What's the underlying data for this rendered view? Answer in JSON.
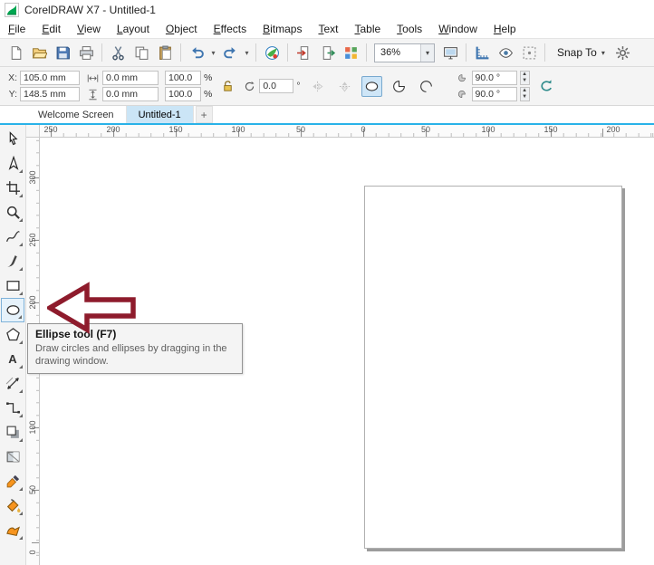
{
  "window": {
    "title": "CorelDRAW X7 - Untitled-1"
  },
  "menu": {
    "items": [
      "File",
      "Edit",
      "View",
      "Layout",
      "Object",
      "Effects",
      "Bitmaps",
      "Text",
      "Table",
      "Tools",
      "Window",
      "Help"
    ]
  },
  "standard_toolbar": {
    "buttons_left": [
      "new-document",
      "open",
      "save",
      "print",
      "|",
      "cut",
      "copy",
      "paste",
      "|",
      "undo",
      "undo-list",
      "redo",
      "redo-list",
      "|",
      "search-content",
      "|",
      "import",
      "export",
      "application-launcher",
      "|"
    ],
    "zoom_level": "36%",
    "buttons_mid": [
      "full-screen-preview",
      "|",
      "show-rulers",
      "preview",
      "dynamic-guides",
      "|"
    ],
    "snap_to_label": "Snap To",
    "buttons_right": [
      "options"
    ]
  },
  "property_bar": {
    "x_label": "X:",
    "x_value": "105.0 mm",
    "y_label": "Y:",
    "y_value": "148.5 mm",
    "width_value": "0.0 mm",
    "height_value": "0.0 mm",
    "scale_h_value": "100.0",
    "scale_v_value": "100.0",
    "percent": "%",
    "rotation_value": "0.0",
    "degree_symbol": "°",
    "start_angle_value": "90.0 °",
    "end_angle_value": "90.0 °"
  },
  "tabs": {
    "items": [
      {
        "label": "Welcome Screen",
        "active": false
      },
      {
        "label": "Untitled-1",
        "active": true
      }
    ],
    "new_tab_label": "+"
  },
  "rulers": {
    "horizontal_labels": [
      "250",
      "200",
      "150",
      "100",
      "50",
      "0",
      "50",
      "100",
      "150",
      "200"
    ],
    "vertical_labels": [
      "300",
      "250",
      "200",
      "150",
      "100",
      "50",
      "0"
    ]
  },
  "toolbox": {
    "tools": [
      {
        "name": "pick-tool",
        "flyout": false
      },
      {
        "name": "shape-tool",
        "flyout": true
      },
      {
        "name": "crop-tool",
        "flyout": true
      },
      {
        "name": "zoom-tool",
        "flyout": true
      },
      {
        "name": "freehand-tool",
        "flyout": true
      },
      {
        "name": "artistic-media-tool",
        "flyout": true
      },
      {
        "name": "rectangle-tool",
        "flyout": true
      },
      {
        "name": "ellipse-tool",
        "flyout": true,
        "highlighted": true
      },
      {
        "name": "polygon-tool",
        "flyout": true
      },
      {
        "name": "text-tool",
        "flyout": true
      },
      {
        "name": "parallel-dimension-tool",
        "flyout": true
      },
      {
        "name": "straight-line-connector-tool",
        "flyout": true
      },
      {
        "name": "drop-shadow-tool",
        "flyout": true
      },
      {
        "name": "transparency-tool",
        "flyout": false
      },
      {
        "name": "color-eyedropper-tool",
        "flyout": true
      },
      {
        "name": "interactive-fill-tool",
        "flyout": true
      },
      {
        "name": "smart-fill-tool",
        "flyout": true
      }
    ]
  },
  "tooltip": {
    "title": "Ellipse tool (F7)",
    "body": "Draw circles and ellipses by dragging in the drawing window."
  },
  "colors": {
    "accent": "#29b2e8",
    "callout": "#8e1b2c",
    "highlight_orange": "#f7941d"
  }
}
